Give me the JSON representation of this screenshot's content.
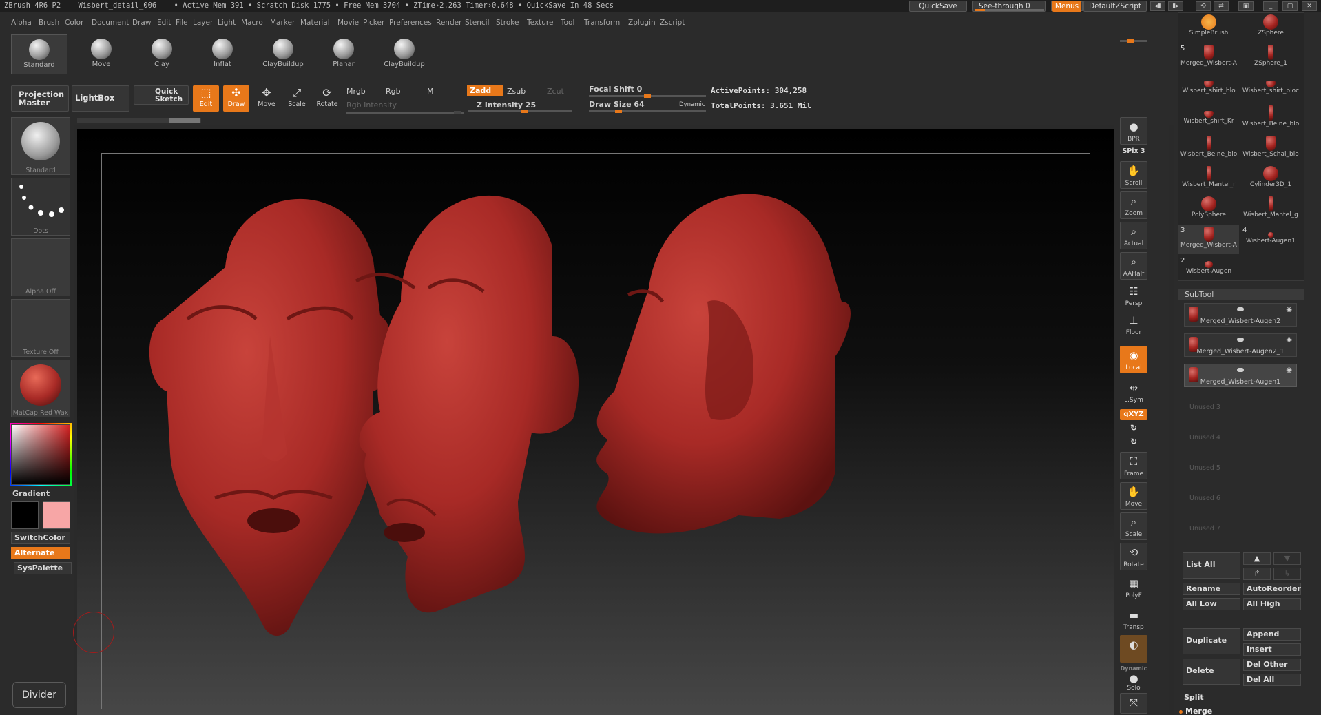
{
  "titlebar": {
    "status": "ZBrush 4R6 P2    Wisbert_detail_006    • Active Mem 391 • Scratch Disk 1775 • Free Mem 3704 • ZTime›2.263 Timer›0.648 • QuickSave In 48 Secs",
    "quicksave": "QuickSave",
    "see_through": "See-through  0",
    "menus": "Menus",
    "script": "DefaultZScript"
  },
  "menu": [
    "Alpha",
    "Brush",
    "Color",
    "Document",
    "Draw",
    "Edit",
    "File",
    "Layer",
    "Light",
    "Macro",
    "Marker",
    "Material",
    "Movie",
    "Picker",
    "Preferences",
    "Render",
    "Stencil",
    "Stroke",
    "Texture",
    "Tool",
    "Transform",
    "Zplugin",
    "Zscript"
  ],
  "brushes": [
    "Standard",
    "Move",
    "Clay",
    "Inflat",
    "ClayBuildup",
    "Planar",
    "ClayBuildup"
  ],
  "toolbar": {
    "projection_master": "Projection Master",
    "lightbox": "LightBox",
    "quick_sketch": "Quick Sketch",
    "edit": "Edit",
    "draw": "Draw",
    "move": "Move",
    "scale": "Scale",
    "rotate": "Rotate",
    "mrgb": "Mrgb",
    "rgb": "Rgb",
    "m": "M",
    "rgb_intensity": "Rgb Intensity",
    "zadd": "Zadd",
    "zsub": "Zsub",
    "zcut": "Zcut",
    "z_intensity": "Z Intensity 25",
    "focal_shift": "Focal Shift 0",
    "draw_size": "Draw Size 64",
    "dynamic": "Dynamic",
    "active_points": "ActivePoints: 304,258",
    "total_points": "TotalPoints: 3.651  Mil"
  },
  "left": {
    "standard": "Standard",
    "dots": "Dots",
    "alpha": "Alpha  Off",
    "texture": "Texture  Off",
    "matcap": "MatCap  Red  Wax",
    "gradient": "Gradient",
    "switchcolor": "SwitchColor",
    "alternate": "Alternate",
    "syspalette": "SysPalette",
    "divider": "Divider"
  },
  "right": {
    "bpr": "BPR",
    "spix": "SPix 3",
    "scroll": "Scroll",
    "zoom": "Zoom",
    "actual": "Actual",
    "aahalf": "AAHalf",
    "persp": "Persp",
    "floor": "Floor",
    "local": "Local",
    "lsym": "L.Sym",
    "xyz": "qXYZ",
    "frame": "Frame",
    "move": "Move",
    "scale": "Scale",
    "rotate": "Rotate",
    "polyf": "PolyF",
    "transp": "Transp",
    "dynamic": "Dynamic",
    "solo": "Solo"
  },
  "tools": [
    {
      "num": "",
      "name": "SimpleBrush"
    },
    {
      "num": "",
      "name": "ZSphere"
    },
    {
      "num": "5",
      "name": "Merged_Wisbert-A"
    },
    {
      "num": "",
      "name": "ZSphere_1"
    },
    {
      "num": "",
      "name": "Wisbert_shirt_blo"
    },
    {
      "num": "",
      "name": "Wisbert_shirt_bloc"
    },
    {
      "num": "",
      "name": "Wisbert_shirt_Kr"
    },
    {
      "num": "",
      "name": "Wisbert_Beine_blo"
    },
    {
      "num": "",
      "name": "Wisbert_Beine_blo"
    },
    {
      "num": "",
      "name": "Wisbert_Schal_blo"
    },
    {
      "num": "",
      "name": "Wisbert_Mantel_r"
    },
    {
      "num": "",
      "name": "Cylinder3D_1"
    },
    {
      "num": "",
      "name": "PolySphere"
    },
    {
      "num": "",
      "name": "Wisbert_Mantel_g"
    },
    {
      "num": "3",
      "name": "Merged_Wisbert-A"
    },
    {
      "num": "4",
      "name": "Wisbert-Augen1"
    },
    {
      "num": "2",
      "name": "Wisbert-Augen"
    }
  ],
  "subtool": {
    "header": "SubTool",
    "items": [
      "Merged_Wisbert-Augen2",
      "Merged_Wisbert-Augen2_1",
      "Merged_Wisbert-Augen1"
    ],
    "unused": [
      "Unused 3",
      "Unused 4",
      "Unused 5",
      "Unused 6",
      "Unused 7"
    ],
    "list_all": "List  All",
    "rename": "Rename",
    "autoreorder": "AutoReorder",
    "all_low": "All  Low",
    "all_high": "All  High",
    "duplicate": "Duplicate",
    "append": "Append",
    "insert": "Insert",
    "delete": "Delete",
    "del_other": "Del  Other",
    "del_all": "Del  All",
    "split": "Split",
    "merge": "Merge"
  },
  "colors": {
    "accent": "#e8781a",
    "clay": "#a82a26"
  }
}
